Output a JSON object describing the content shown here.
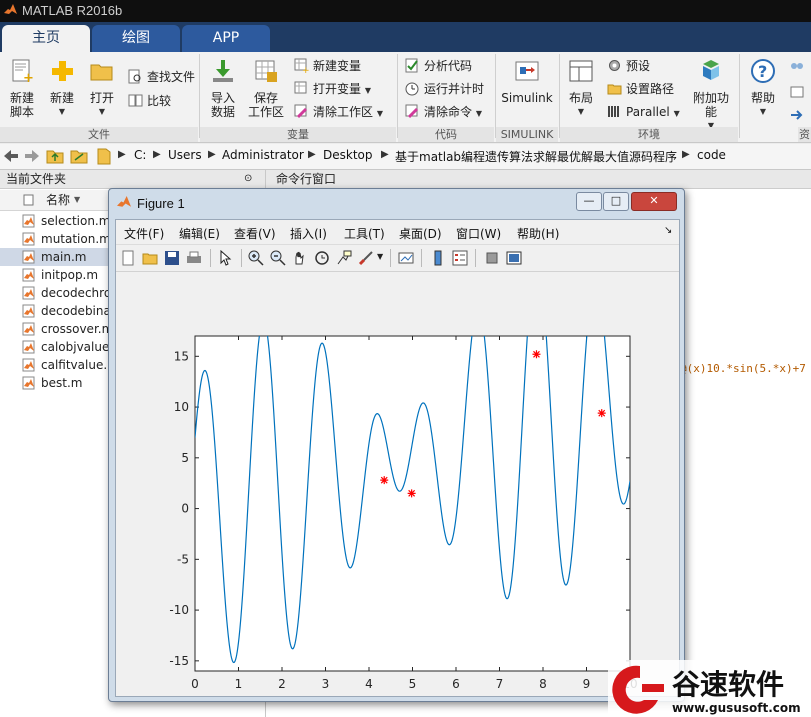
{
  "app": {
    "title": "MATLAB R2016b"
  },
  "tabs": [
    {
      "label": "主页"
    },
    {
      "label": "绘图"
    },
    {
      "label": "APP"
    }
  ],
  "ribbon": {
    "file": {
      "new_script": "新建\n脚本",
      "new": "新建",
      "open": "打开",
      "find_files": "查找文件",
      "compare": "比较",
      "group": "文件"
    },
    "variable": {
      "import": "导入\n数据",
      "save_ws": "保存\n工作区",
      "new_var": "新建变量",
      "open_var": "打开变量",
      "clear_ws": "清除工作区",
      "group": "变量"
    },
    "code": {
      "analyze": "分析代码",
      "run_time": "运行并计时",
      "clear_cmd": "清除命令",
      "group": "代码"
    },
    "simulink": {
      "label": "Simulink",
      "group": "SIMULINK"
    },
    "env": {
      "layout": "布局",
      "prefs": "预设",
      "set_path": "设置路径",
      "parallel": "Parallel",
      "addons": "附加功能",
      "group": "环境"
    },
    "resources": {
      "help": "帮助",
      "group_partial": "资"
    }
  },
  "address": {
    "path": [
      "C:",
      "Users",
      "Administrator",
      "Desktop",
      "基于matlab编程遗传算法求解最优解最大值源码程序",
      "code"
    ]
  },
  "left_panel": {
    "title": "当前文件夹",
    "column_name": "名称",
    "files": [
      "selection.m",
      "mutation.m",
      "main.m",
      "initpop.m",
      "decodechrom.m",
      "decodebinary.m",
      "crossover.m",
      "calobjvalue.m",
      "calfitvalue.m",
      "best.m"
    ],
    "selected_index": 2
  },
  "command_window": {
    "title": "命令行窗口",
    "code_fragment": "@(x)10.*sin(5.*x)+7"
  },
  "figure": {
    "title": "Figure 1",
    "menu": [
      "文件(F)",
      "编辑(E)",
      "查看(V)",
      "插入(I)",
      "工具(T)",
      "桌面(D)",
      "窗口(W)",
      "帮助(H)"
    ],
    "window_buttons": {
      "minimize": "—",
      "maximize": "□",
      "close": "✕"
    }
  },
  "chart_data": {
    "type": "line",
    "xlim": [
      0,
      10
    ],
    "ylim": [
      -16,
      17
    ],
    "xticks": [
      0,
      1,
      2,
      3,
      4,
      5,
      6,
      7,
      8,
      9,
      10
    ],
    "yticks": [
      -15,
      -10,
      -5,
      0,
      5,
      10,
      15
    ],
    "series": [
      {
        "style": "line",
        "color": "#0072bd",
        "sampled_from": "y = x + 10*sin(5*x) + 7*cos(4*x)",
        "function_params": {
          "a": 10,
          "b": 5,
          "c": 7,
          "d": 4
        }
      },
      {
        "style": "markers",
        "marker": "*",
        "color": "#ff0000",
        "points": [
          [
            4.35,
            2.8
          ],
          [
            4.98,
            1.5
          ],
          [
            7.85,
            15.2
          ],
          [
            9.35,
            9.4
          ]
        ]
      }
    ],
    "title": "",
    "xlabel": "",
    "ylabel": "",
    "grid": false
  },
  "watermark": {
    "brand": "谷速软件",
    "url": "www.gususoft.com",
    "color": "#d6191c"
  }
}
